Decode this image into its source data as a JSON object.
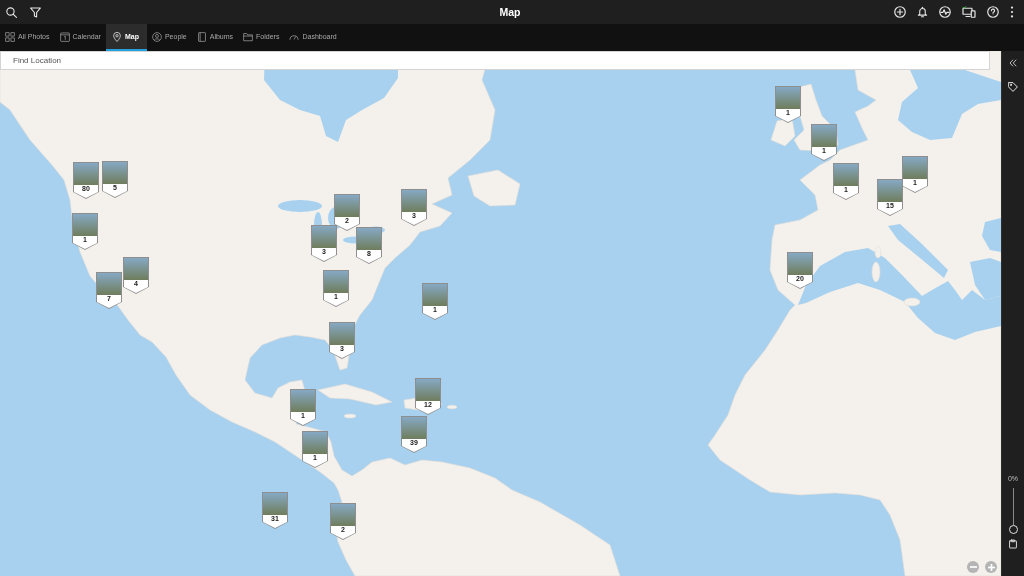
{
  "window": {
    "title": "Map"
  },
  "tabs": [
    {
      "label": "All Photos",
      "selected": false
    },
    {
      "label": "Calendar",
      "selected": false
    },
    {
      "label": "Map",
      "selected": true
    },
    {
      "label": "People",
      "selected": false
    },
    {
      "label": "Albums",
      "selected": false
    },
    {
      "label": "Folders",
      "selected": false
    },
    {
      "label": "Dashboard",
      "selected": false
    }
  ],
  "search": {
    "placeholder": "Find Location"
  },
  "markers": [
    {
      "count": "1"
    },
    {
      "count": "1"
    },
    {
      "count": "1"
    },
    {
      "count": "80"
    },
    {
      "count": "5"
    },
    {
      "count": "1"
    },
    {
      "count": "15"
    },
    {
      "count": "3"
    },
    {
      "count": "2"
    },
    {
      "count": "1"
    },
    {
      "count": "3"
    },
    {
      "count": "8"
    },
    {
      "count": "20"
    },
    {
      "count": "4"
    },
    {
      "count": "1"
    },
    {
      "count": "7"
    },
    {
      "count": "1"
    },
    {
      "count": "3"
    },
    {
      "count": "12"
    },
    {
      "count": "1"
    },
    {
      "count": "39"
    },
    {
      "count": "1"
    },
    {
      "count": "31"
    },
    {
      "count": "2"
    }
  ],
  "side_panel": {
    "slider": {
      "reading": "0%",
      "level": 0
    }
  }
}
